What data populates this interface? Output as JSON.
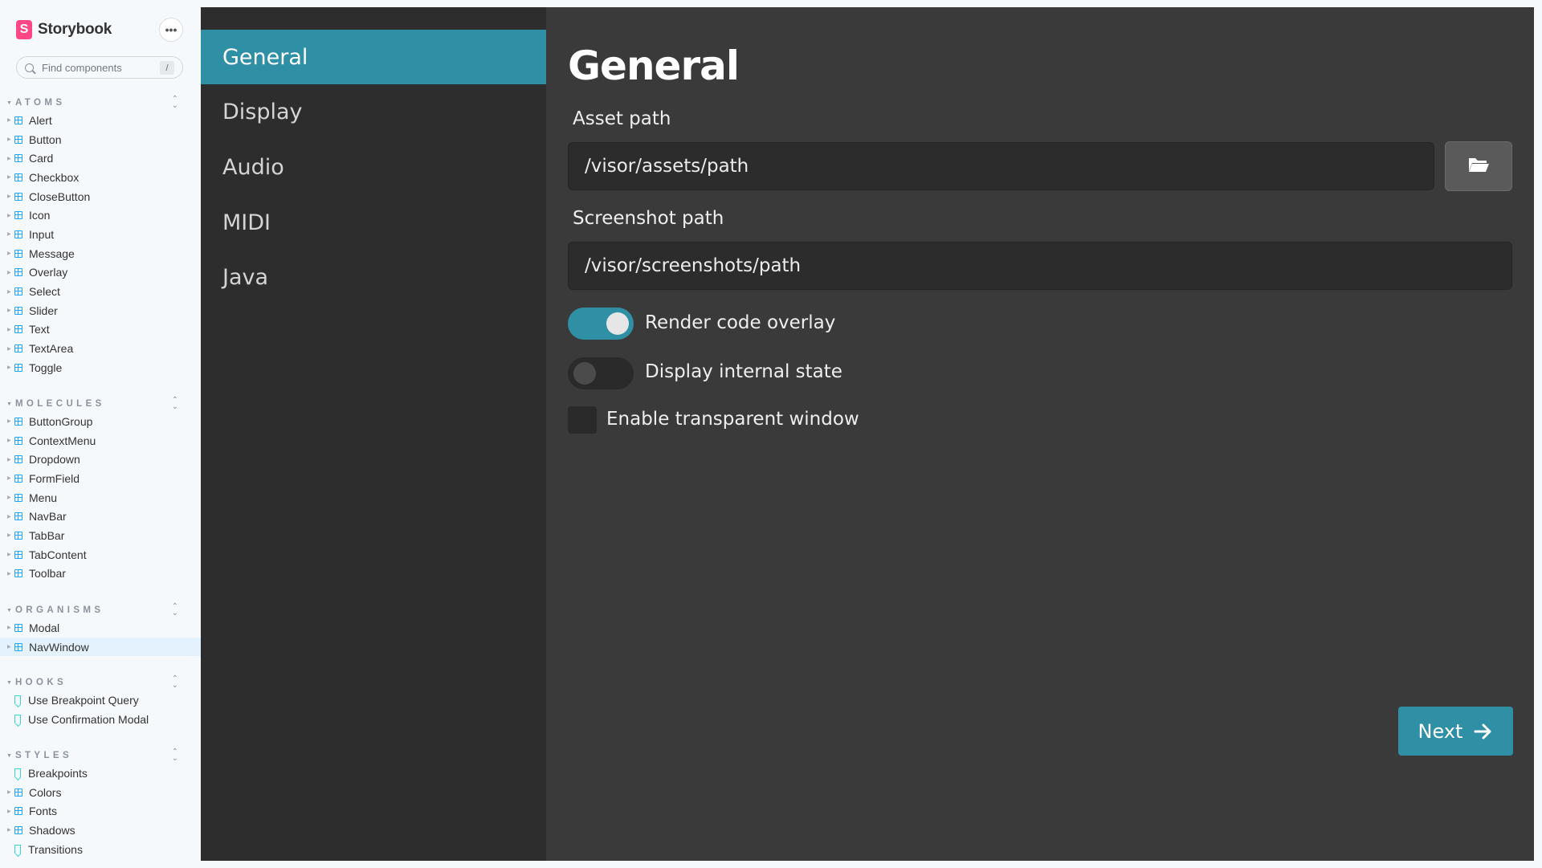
{
  "app": {
    "brand": "Storybook",
    "logo_letter": "S",
    "menu_glyph": "•••"
  },
  "search": {
    "placeholder": "Find components",
    "shortcut": "/"
  },
  "groups": [
    {
      "title": "ATOMS",
      "items": [
        "Alert",
        "Button",
        "Card",
        "Checkbox",
        "CloseButton",
        "Icon",
        "Input",
        "Message",
        "Overlay",
        "Select",
        "Slider",
        "Text",
        "TextArea",
        "Toggle"
      ]
    },
    {
      "title": "MOLECULES",
      "items": [
        "ButtonGroup",
        "ContextMenu",
        "Dropdown",
        "FormField",
        "Menu",
        "NavBar",
        "TabBar",
        "TabContent",
        "Toolbar"
      ]
    },
    {
      "title": "ORGANISMS",
      "items": [
        "Modal",
        "NavWindow"
      ],
      "selected": "NavWindow"
    },
    {
      "title": "HOOKS",
      "items": [
        "Use Breakpoint Query",
        "Use Confirmation Modal"
      ]
    },
    {
      "title": "STYLES",
      "items": [
        "Breakpoints",
        "Colors",
        "Fonts",
        "Shadows",
        "Transitions"
      ]
    }
  ],
  "story": {
    "nav": [
      "General",
      "Display",
      "Audio",
      "MIDI",
      "Java"
    ],
    "active_nav": "General",
    "title": "General",
    "asset_label": "Asset path",
    "asset_value": "/visor/assets/path",
    "screenshot_label": "Screenshot path",
    "screenshot_value": "/visor/screenshots/path",
    "toggle1_label": "Render code overlay",
    "toggle1_on": true,
    "toggle2_label": "Display internal state",
    "toggle2_on": false,
    "checkbox_label": "Enable transparent window",
    "checkbox_checked": false,
    "next_label": "Next"
  },
  "colors": {
    "accent": "#2f8fa5",
    "panel": "#3a3a3a",
    "nav": "#2d2d2d",
    "sidebar": "#f6f9fc",
    "storybook_pink": "#ff4785"
  }
}
